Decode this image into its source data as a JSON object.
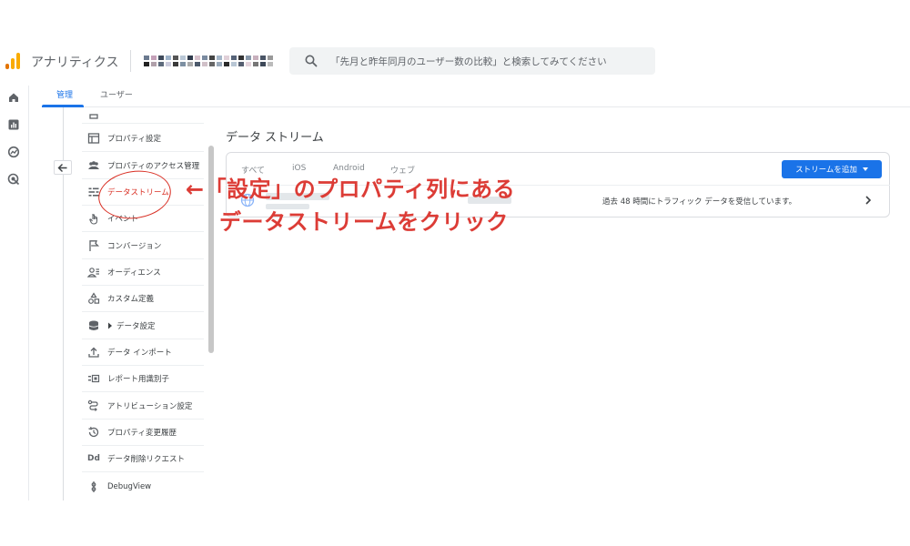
{
  "header": {
    "app_name": "アナリティクス",
    "search_placeholder": "「先月と昨年同月のユーザー数の比較」と検索してみてください"
  },
  "tabs": [
    {
      "label": "管理",
      "active": true
    },
    {
      "label": "ユーザー",
      "active": false
    }
  ],
  "menu": {
    "items": [
      {
        "label": "プロパティ設定",
        "icon": "window-icon"
      },
      {
        "label": "プロパティのアクセス管理",
        "icon": "people-icon"
      },
      {
        "label": "データストリーム",
        "icon": "streams-icon",
        "selected": true
      },
      {
        "label": "イベント",
        "icon": "touch-icon"
      },
      {
        "label": "コンバージョン",
        "icon": "flag-icon"
      },
      {
        "label": "オーディエンス",
        "icon": "audience-icon"
      },
      {
        "label": "カスタム定義",
        "icon": "shapes-icon"
      },
      {
        "label": "データ設定",
        "icon": "database-icon"
      },
      {
        "label": "データ インポート",
        "icon": "upload-icon"
      },
      {
        "label": "レポート用識別子",
        "icon": "identifier-icon"
      },
      {
        "label": "アトリビューション設定",
        "icon": "route-icon"
      },
      {
        "label": "プロパティ変更履歴",
        "icon": "history-icon"
      },
      {
        "label": "データ削除リクエスト",
        "icon": "dd-icon"
      },
      {
        "label": "DebugView",
        "icon": "debug-icon"
      }
    ],
    "dd_glyph": "Dd"
  },
  "main": {
    "title": "データ ストリーム",
    "filter_tabs": [
      "すべて",
      "iOS",
      "Android",
      "ウェブ"
    ],
    "add_stream_label": "ストリームを追加",
    "stream_status": "過去 48 時間にトラフィック データを受信しています。"
  },
  "annotation": {
    "line1": "←「設定」のプロパティ列にある",
    "line2": "データストリームをクリック"
  },
  "colors": {
    "accent": "#1a73e8",
    "annotation_red": "#dc3c36",
    "logo_orange": "#f9ab00",
    "logo_dark": "#e37400"
  }
}
